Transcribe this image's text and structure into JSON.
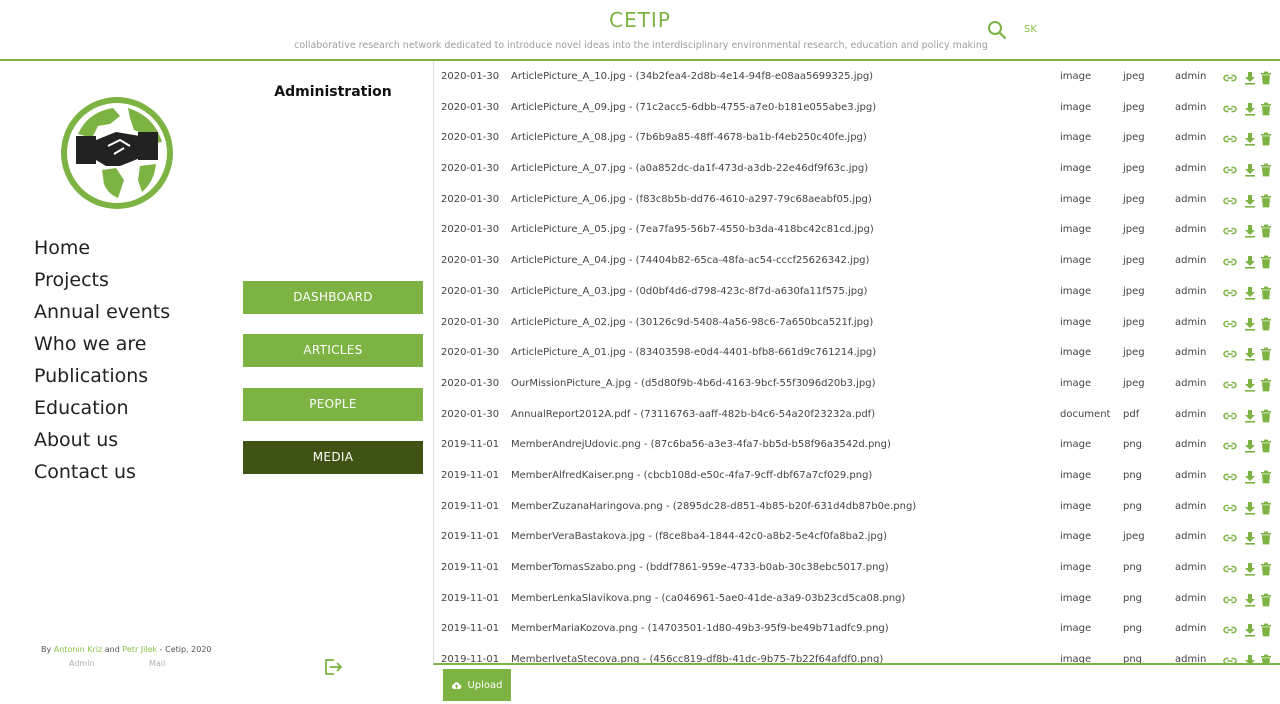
{
  "header": {
    "brand": "CETIP",
    "tagline": "collaborative research network dedicated to introduce novel ideas into the interdisciplinary environmental research, education and policy making",
    "language": "SK"
  },
  "nav": [
    "Home",
    "Projects",
    "Annual events",
    "Who we are",
    "Publications",
    "Education",
    "About us",
    "Contact us"
  ],
  "credits": {
    "by": "By ",
    "author1": "Antonin Kriz",
    "and": " and ",
    "author2": "Petr Jilek",
    "suffix": " - Cetip, 2020",
    "admin_link": "Admin",
    "mail_link": "Mail"
  },
  "admin": {
    "title": "Administration",
    "buttons": [
      "DASHBOARD",
      "ARTICLES",
      "PEOPLE",
      "MEDIA"
    ],
    "active": "MEDIA"
  },
  "media": [
    {
      "date": "2020-01-30",
      "name": "ArticlePicture_A_10.jpg - (34b2fea4-2d8b-4e14-94f8-e08aa5699325.jpg)",
      "type": "image",
      "ext": "jpeg",
      "user": "admin"
    },
    {
      "date": "2020-01-30",
      "name": "ArticlePicture_A_09.jpg - (71c2acc5-6dbb-4755-a7e0-b181e055abe3.jpg)",
      "type": "image",
      "ext": "jpeg",
      "user": "admin"
    },
    {
      "date": "2020-01-30",
      "name": "ArticlePicture_A_08.jpg - (7b6b9a85-48ff-4678-ba1b-f4eb250c40fe.jpg)",
      "type": "image",
      "ext": "jpeg",
      "user": "admin"
    },
    {
      "date": "2020-01-30",
      "name": "ArticlePicture_A_07.jpg - (a0a852dc-da1f-473d-a3db-22e46df9f63c.jpg)",
      "type": "image",
      "ext": "jpeg",
      "user": "admin"
    },
    {
      "date": "2020-01-30",
      "name": "ArticlePicture_A_06.jpg - (f83c8b5b-dd76-4610-a297-79c68aeabf05.jpg)",
      "type": "image",
      "ext": "jpeg",
      "user": "admin"
    },
    {
      "date": "2020-01-30",
      "name": "ArticlePicture_A_05.jpg - (7ea7fa95-56b7-4550-b3da-418bc42c81cd.jpg)",
      "type": "image",
      "ext": "jpeg",
      "user": "admin"
    },
    {
      "date": "2020-01-30",
      "name": "ArticlePicture_A_04.jpg - (74404b82-65ca-48fa-ac54-cccf25626342.jpg)",
      "type": "image",
      "ext": "jpeg",
      "user": "admin"
    },
    {
      "date": "2020-01-30",
      "name": "ArticlePicture_A_03.jpg - (0d0bf4d6-d798-423c-8f7d-a630fa11f575.jpg)",
      "type": "image",
      "ext": "jpeg",
      "user": "admin"
    },
    {
      "date": "2020-01-30",
      "name": "ArticlePicture_A_02.jpg - (30126c9d-5408-4a56-98c6-7a650bca521f.jpg)",
      "type": "image",
      "ext": "jpeg",
      "user": "admin"
    },
    {
      "date": "2020-01-30",
      "name": "ArticlePicture_A_01.jpg - (83403598-e0d4-4401-bfb8-661d9c761214.jpg)",
      "type": "image",
      "ext": "jpeg",
      "user": "admin"
    },
    {
      "date": "2020-01-30",
      "name": "OurMissionPicture_A.jpg - (d5d80f9b-4b6d-4163-9bcf-55f3096d20b3.jpg)",
      "type": "image",
      "ext": "jpeg",
      "user": "admin"
    },
    {
      "date": "2020-01-30",
      "name": "AnnualReport2012A.pdf - (73116763-aaff-482b-b4c6-54a20f23232a.pdf)",
      "type": "document",
      "ext": "pdf",
      "user": "admin"
    },
    {
      "date": "2019-11-01",
      "name": "MemberAndrejUdovic.png - (87c6ba56-a3e3-4fa7-bb5d-b58f96a3542d.png)",
      "type": "image",
      "ext": "png",
      "user": "admin"
    },
    {
      "date": "2019-11-01",
      "name": "MemberAlfredKaiser.png - (cbcb108d-e50c-4fa7-9cff-dbf67a7cf029.png)",
      "type": "image",
      "ext": "png",
      "user": "admin"
    },
    {
      "date": "2019-11-01",
      "name": "MemberZuzanaHaringova.png - (2895dc28-d851-4b85-b20f-631d4db87b0e.png)",
      "type": "image",
      "ext": "png",
      "user": "admin"
    },
    {
      "date": "2019-11-01",
      "name": "MemberVeraBastakova.jpg - (f8ce8ba4-1844-42c0-a8b2-5e4cf0fa8ba2.jpg)",
      "type": "image",
      "ext": "jpeg",
      "user": "admin"
    },
    {
      "date": "2019-11-01",
      "name": "MemberTomasSzabo.png - (bddf7861-959e-4733-b0ab-30c38ebc5017.png)",
      "type": "image",
      "ext": "png",
      "user": "admin"
    },
    {
      "date": "2019-11-01",
      "name": "MemberLenkaSlavikova.png - (ca046961-5ae0-41de-a3a9-03b23cd5ca08.png)",
      "type": "image",
      "ext": "png",
      "user": "admin"
    },
    {
      "date": "2019-11-01",
      "name": "MemberMariaKozova.png - (14703501-1d80-49b3-95f9-be49b71adfc9.png)",
      "type": "image",
      "ext": "png",
      "user": "admin"
    },
    {
      "date": "2019-11-01",
      "name": "MemberIvetaStecova.png - (456cc819-df8b-41dc-9b75-7b22f64afdf0.png)",
      "type": "image",
      "ext": "png",
      "user": "admin"
    }
  ],
  "upload_label": "Upload",
  "colors": {
    "accent": "#7cb342",
    "active": "#3e5314",
    "logo_dark": "#222222"
  },
  "icons": [
    "search-icon",
    "globe-handshake-logo",
    "link-icon",
    "download-icon",
    "trash-icon",
    "cloud-upload-icon",
    "logout-icon"
  ]
}
